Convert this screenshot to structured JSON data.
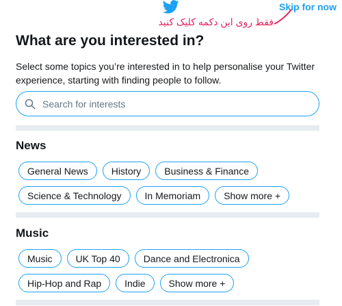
{
  "header": {
    "logo_icon": "twitter-bird-icon",
    "skip_label": "Skip for now",
    "annotation": "فقط روی این دکمه کلیک کنید"
  },
  "title": "What are you interested in?",
  "subtitle": "Select some topics you’re interested in to help personalise your Twitter experience, starting with finding people to follow.",
  "search": {
    "placeholder": "Search for interests",
    "icon": "search-icon"
  },
  "sections": {
    "news": {
      "title": "News",
      "chips": [
        "General News",
        "History",
        "Business & Finance",
        "Science & Technology",
        "In Memoriam"
      ],
      "show_more": "Show more +"
    },
    "music": {
      "title": "Music",
      "chips": [
        "Music",
        "UK Top 40",
        "Dance and Electronica",
        "Hip-Hop and Rap",
        "Indie"
      ],
      "show_more": "Show more +"
    }
  },
  "colors": {
    "accent": "#1da1f2",
    "annotation": "#e0245e",
    "divider": "#e6ecf0"
  }
}
